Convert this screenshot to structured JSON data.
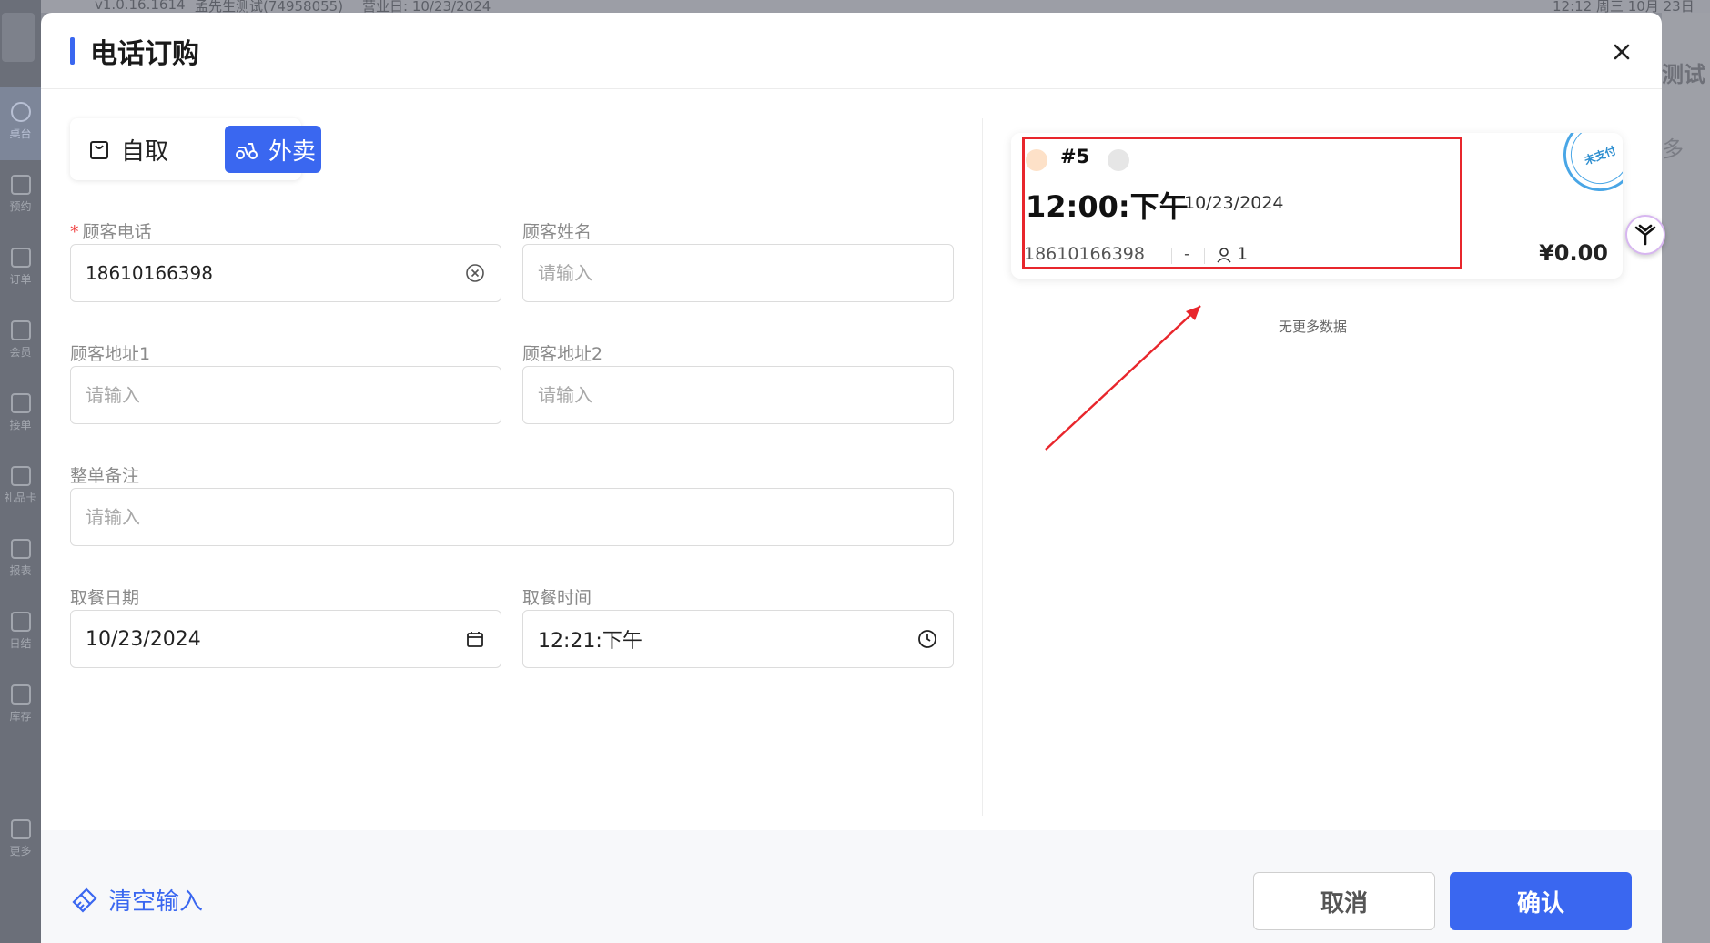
{
  "background": {
    "version": "v1.0.16.1614",
    "store": "孟先生测试(74958055)",
    "business_day": "营业日: 10/23/2024",
    "clock": "12:12 周三 10月 23日",
    "right_title": "测试",
    "right_more": "多",
    "sidebar": [
      {
        "label": "桌台",
        "icon": "table-icon"
      },
      {
        "label": "预约",
        "icon": "reservation-icon"
      },
      {
        "label": "订单",
        "icon": "orders-icon"
      },
      {
        "label": "会员",
        "icon": "member-icon"
      },
      {
        "label": "接单",
        "icon": "accept-order-icon"
      },
      {
        "label": "礼品卡",
        "icon": "gift-card-icon"
      },
      {
        "label": "报表",
        "icon": "report-icon"
      },
      {
        "label": "日结",
        "icon": "daily-close-icon"
      },
      {
        "label": "库存",
        "icon": "inventory-icon"
      },
      {
        "label": "更多",
        "icon": "more-icon"
      }
    ]
  },
  "modal": {
    "title": "电话订购",
    "tabs": {
      "pickup": "自取",
      "delivery": "外卖"
    },
    "form": {
      "phone": {
        "label": "顾客电话",
        "value": "18610166398"
      },
      "name": {
        "label": "顾客姓名",
        "placeholder": "请输入"
      },
      "address1": {
        "label": "顾客地址1",
        "placeholder": "请输入"
      },
      "address2": {
        "label": "顾客地址2",
        "placeholder": "请输入"
      },
      "note": {
        "label": "整单备注",
        "placeholder": "请输入"
      },
      "pickup_date": {
        "label": "取餐日期",
        "value": "10/23/2024"
      },
      "pickup_time": {
        "label": "取餐时间",
        "value": "12:21:下午"
      }
    },
    "order_card": {
      "number": "#5",
      "time": "12:00:下午",
      "date": "10/23/2024",
      "phone": "18610166398",
      "dash": "-",
      "guests": "1",
      "amount": "¥0.00",
      "stamp": "未支付"
    },
    "no_more": "无更多数据",
    "footer": {
      "clear": "清空输入",
      "cancel": "取消",
      "confirm": "确认"
    }
  },
  "colors": {
    "accent": "#3a67f0",
    "highlight": "#e8262c",
    "stamp": "#49a6e6"
  }
}
